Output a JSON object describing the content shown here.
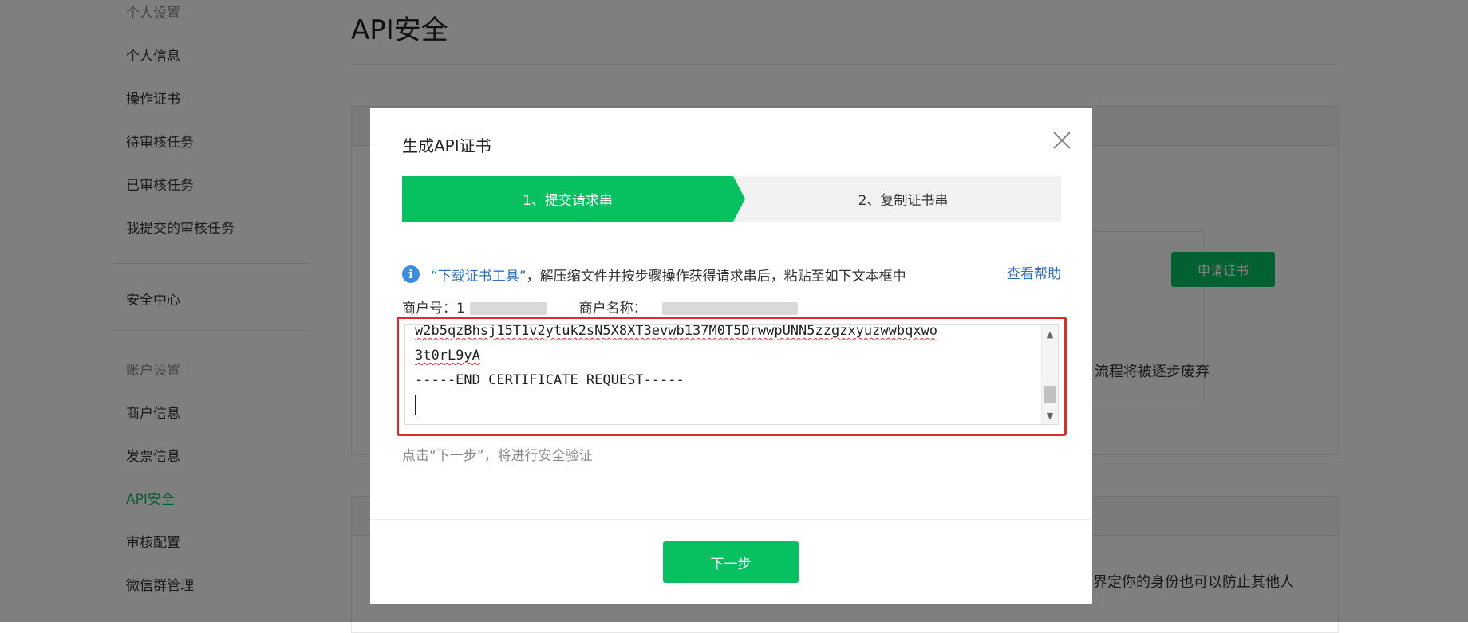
{
  "sidebar": {
    "group_personal": "个人设置",
    "items_personal": [
      "个人信息",
      "操作证书",
      "待审核任务",
      "已审核任务",
      "我提交的审核任务"
    ],
    "security_center": "安全中心",
    "group_account": "账户设置",
    "items_account": [
      "商户信息",
      "发票信息",
      "API安全",
      "审核配置",
      "微信群管理"
    ],
    "active_item": "API安全"
  },
  "main": {
    "page_title": "API安全",
    "apply_button": "申请证书",
    "deprecate_text": "流程将被逐步废弃",
    "identity_text": "界定你的身份也可以防止其他人"
  },
  "modal": {
    "title": "生成API证书",
    "steps": [
      {
        "label": "1、提交请求串",
        "active": true
      },
      {
        "label": "2、复制证书串",
        "active": false
      }
    ],
    "info": {
      "download_link": "“下载证书工具”",
      "instruction": "，解压缩文件并按步骤操作获得请求串后，粘贴至如下文本框中",
      "help_link": "查看帮助"
    },
    "merchant": {
      "id_label": "商户号：",
      "id_value_visible": "1",
      "name_label": "商户名称："
    },
    "textarea_lines": [
      "w2b5qzBhsj15T1v2ytuk2sN5X8XT3evwb137M0T5DrwwpUNN5zzgzxyuzwwbqxwo",
      "3t0rL9yA",
      "-----END CERTIFICATE REQUEST-----"
    ],
    "hint": "点击“下一步”，将进行安全验证",
    "next_button": "下一步"
  },
  "colors": {
    "accent": "#07c160",
    "link": "#2f6fbd",
    "highlight_border": "#e02b2b",
    "info_icon": "#3c8dde"
  },
  "icons": {
    "close": "close-icon",
    "info": "info-icon"
  }
}
